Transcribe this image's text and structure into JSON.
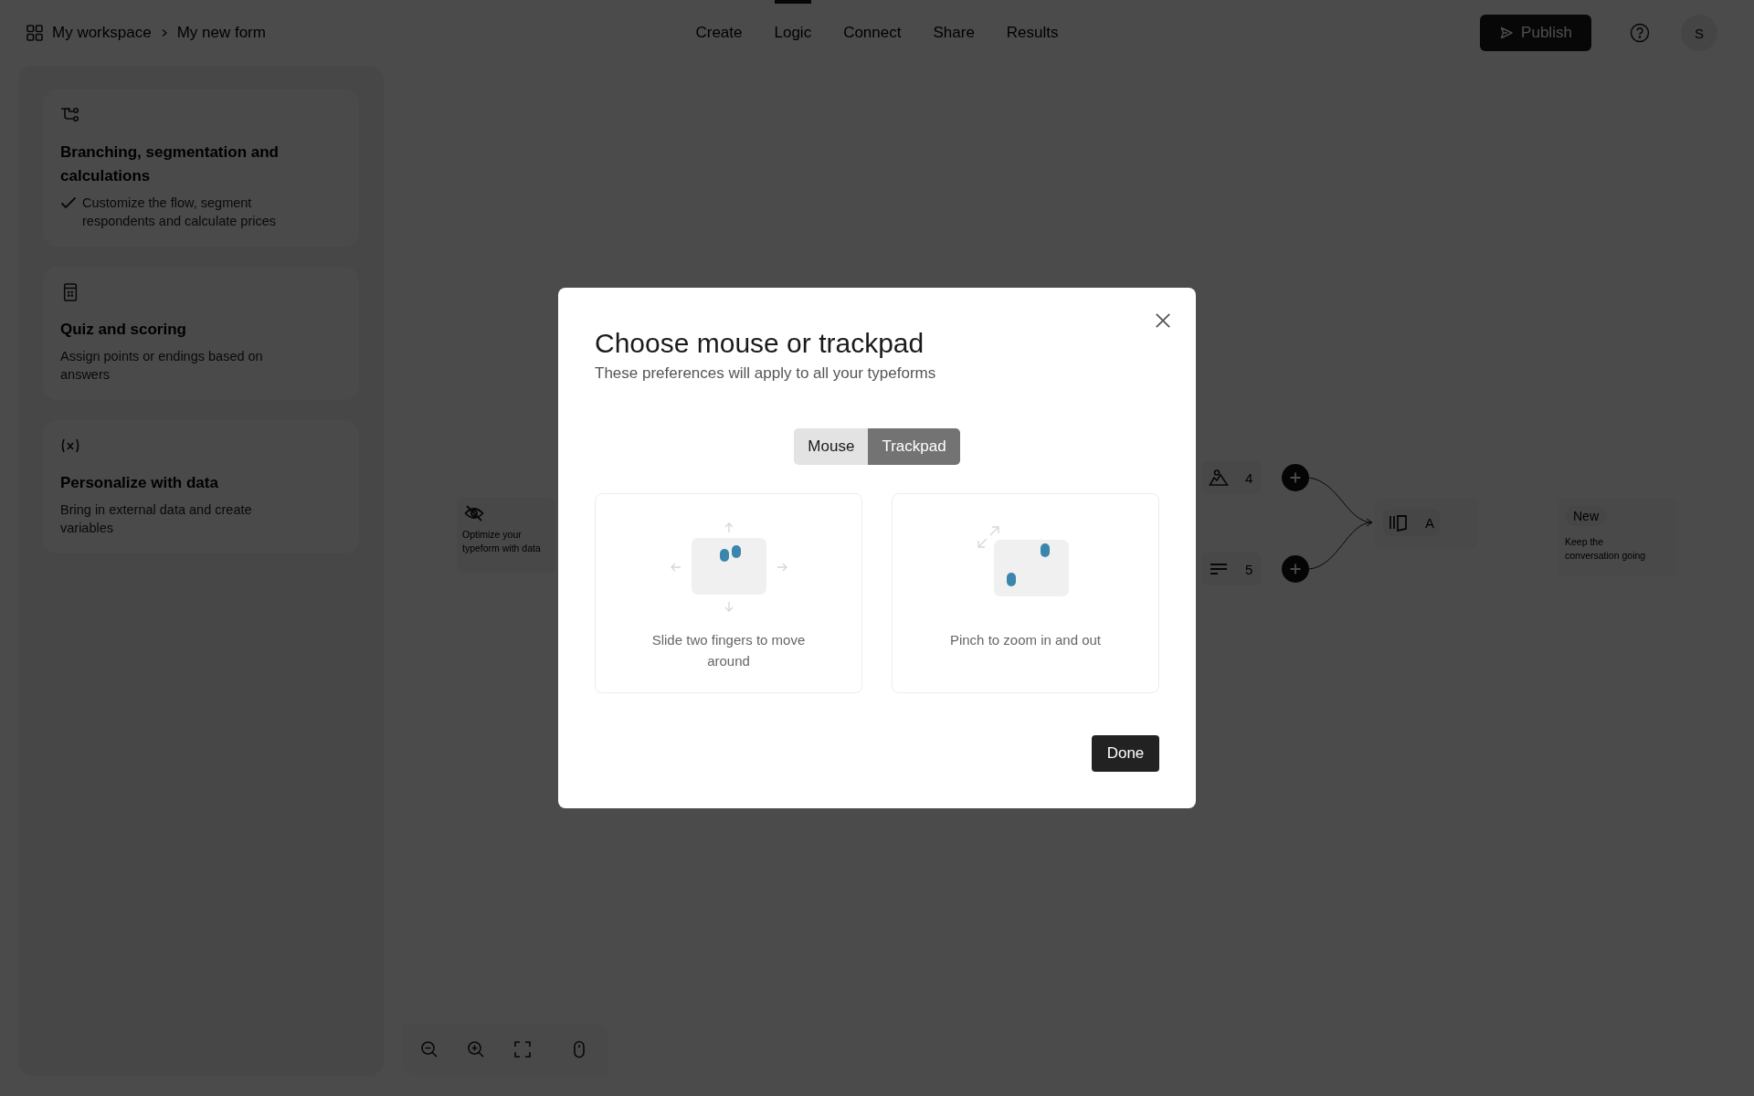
{
  "breadcrumb": [
    "My workspace",
    "My new form"
  ],
  "nav": [
    {
      "label": "Create",
      "selected": false
    },
    {
      "label": "Logic",
      "selected": true
    },
    {
      "label": "Connect",
      "selected": false
    },
    {
      "label": "Share",
      "selected": false
    },
    {
      "label": "Results",
      "selected": false
    }
  ],
  "publish_button": "Publish",
  "avatar": "S",
  "feature_cards": [
    {
      "kind": "branching",
      "title": "Branching, segmentation and calculations",
      "description": "Customize the flow, segment respondents and calculate prices",
      "checked": true
    },
    {
      "kind": "quiz",
      "title": "Quiz and scoring",
      "description": "Assign points or endings based on answers",
      "checked": false
    },
    {
      "kind": "variables",
      "title": "Personalize with data",
      "description": "Bring in external data and create variables",
      "checked": false
    }
  ],
  "canvas": {
    "hint_node": {
      "text": "Optimize your typeform with data"
    },
    "question_nodes": [
      {
        "kind": "picture",
        "number": "4"
      },
      {
        "kind": "text",
        "number": "5"
      }
    ],
    "target_node": {
      "label": "A"
    },
    "ending_node": {
      "badge": "New",
      "text": "Keep the conversation going"
    }
  },
  "modal": {
    "title": "Choose mouse or trackpad",
    "subtitle": "These preferences will apply to all your typeforms",
    "options": [
      {
        "label": "Mouse",
        "selected": false
      },
      {
        "label": "Trackpad",
        "selected": true
      }
    ],
    "gestures": [
      {
        "kind": "slide",
        "caption": "Slide two fingers to move around"
      },
      {
        "kind": "pinch",
        "caption": "Pinch to zoom in and out"
      }
    ],
    "done_button": "Done"
  }
}
